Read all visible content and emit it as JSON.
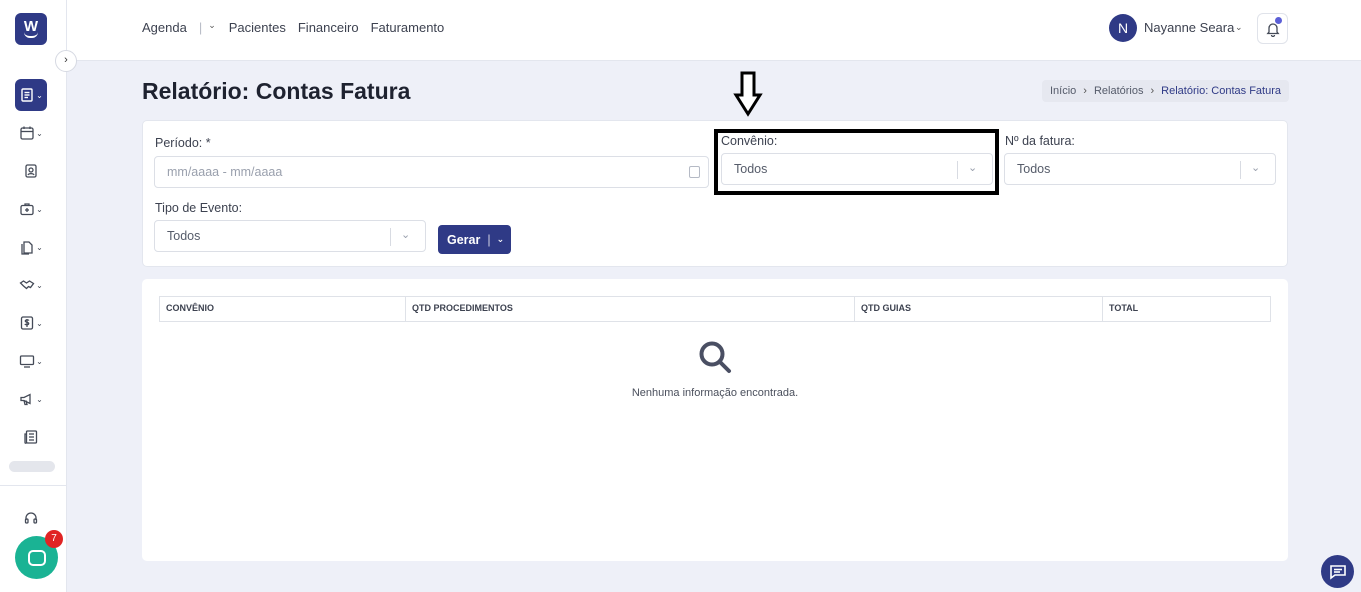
{
  "app": {
    "logo_letter": "W",
    "nav": {
      "agenda": "Agenda",
      "pacientes": "Pacientes",
      "financeiro": "Financeiro",
      "faturamento": "Faturamento"
    },
    "user": {
      "initial": "N",
      "name": "Nayanne Seara"
    },
    "chat_badge_count": "7"
  },
  "page": {
    "title": "Relatório: Contas Fatura",
    "breadcrumb": [
      "Início",
      "Relatórios",
      "Relatório: Contas Fatura"
    ]
  },
  "filters": {
    "periodo_label": "Período: *",
    "periodo_placeholder": "mm/aaaa - mm/aaaa",
    "convenio_label": "Convênio:",
    "convenio_value": "Todos",
    "fatura_label": "Nº da fatura:",
    "fatura_value": "Todos",
    "tipo_evento_label": "Tipo de Evento:",
    "tipo_evento_value": "Todos",
    "gerar_label": "Gerar"
  },
  "table": {
    "columns": [
      "CONVÊNIO",
      "QTD PROCEDIMENTOS",
      "QTD GUIAS",
      "TOTAL"
    ],
    "rows": [],
    "empty_message": "Nenhuma informação encontrada."
  },
  "colors": {
    "primary": "#2f3a86",
    "chat": "#1ab394",
    "badge": "#e02424",
    "background": "#eef0f8"
  },
  "sidebar_icons": [
    "reports-icon",
    "calendar-icon",
    "patient-icon",
    "medical-kit-icon",
    "documents-icon",
    "handshake-icon",
    "finance-icon",
    "monitor-icon",
    "megaphone-icon",
    "news-icon",
    "headset-icon"
  ]
}
